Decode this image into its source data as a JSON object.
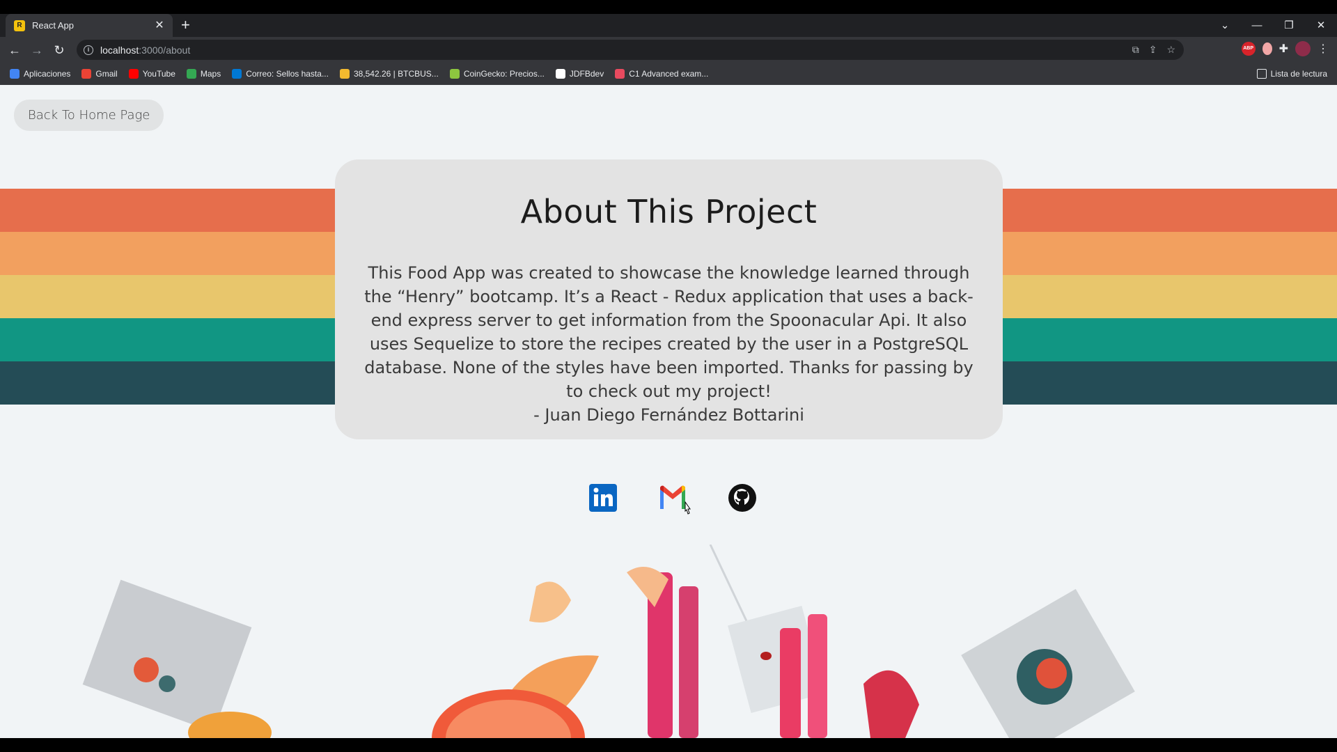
{
  "browser": {
    "tab_title": "React App",
    "tab_close": "✕",
    "new_tab": "+",
    "url_host": "localhost",
    "url_path": ":3000/about",
    "window_controls": [
      "⌄",
      "—",
      "❐",
      "✕"
    ]
  },
  "bookmarks": [
    {
      "label": "Aplicaciones",
      "color": "#4285f4"
    },
    {
      "label": "Gmail",
      "color": "#ea4335"
    },
    {
      "label": "YouTube",
      "color": "#ff0000"
    },
    {
      "label": "Maps",
      "color": "#34a853"
    },
    {
      "label": "Correo: Sellos hasta...",
      "color": "#0078d4"
    },
    {
      "label": "38,542.26 | BTCBUS...",
      "color": "#f3ba2f"
    },
    {
      "label": "CoinGecko: Precios...",
      "color": "#8dc63f"
    },
    {
      "label": "JDFBdev",
      "color": "#ffffff"
    },
    {
      "label": "C1 Advanced exam...",
      "color": "#e84a5f"
    }
  ],
  "reading_list": "Lista de lectura",
  "page": {
    "back_button": "Back To Home Page",
    "title": "About This Project",
    "body": "This Food App was created to showcase the knowledge learned through the “Henry” bootcamp. It’s a React - Redux application that uses a back-end express server to get information from the Spoonacular Api. It also uses Sequelize to store the recipes created by the user in a PostgreSQL database. None of the styles have been imported. Thanks for passing by to check out my project!",
    "signature": "- Juan Diego Fernández Bottarini",
    "stripe_colors": [
      "#e66e4c",
      "#f2a05f",
      "#e8c66c",
      "#119683",
      "#244c56"
    ],
    "socials": [
      {
        "name": "linkedin",
        "color": "#0a66c2"
      },
      {
        "name": "gmail",
        "color": "#ea4335"
      },
      {
        "name": "github",
        "color": "#111111"
      }
    ]
  }
}
